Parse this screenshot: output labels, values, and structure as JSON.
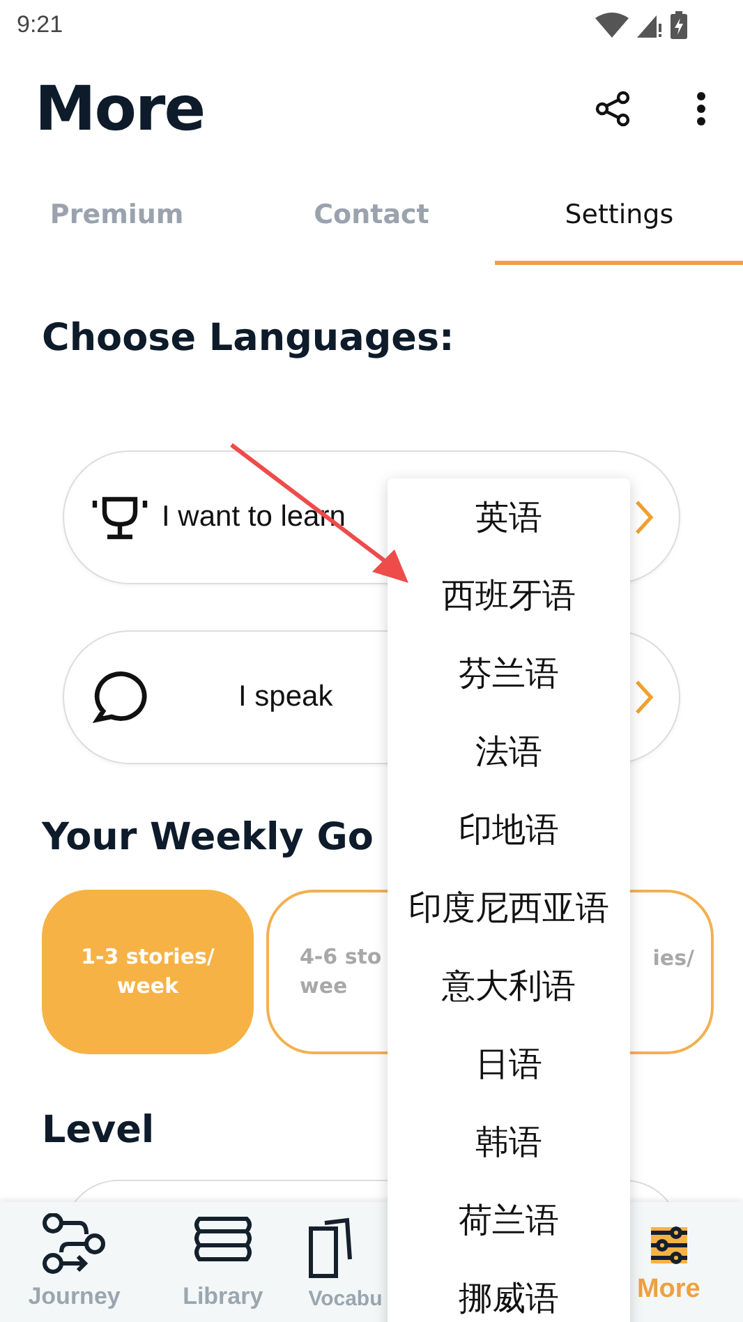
{
  "status_bar": {
    "time": "9:21"
  },
  "header": {
    "title": "More"
  },
  "tabs": [
    {
      "label": "Premium",
      "selected": false
    },
    {
      "label": "Contact",
      "selected": false
    },
    {
      "label": "Settings",
      "selected": true
    }
  ],
  "languages": {
    "title": "Choose Languages:",
    "rows": [
      {
        "kind": "learn",
        "label": "I want to learn"
      },
      {
        "kind": "speak",
        "label": "I speak"
      }
    ]
  },
  "weekly_goal": {
    "title": "Your Weekly Go",
    "options": [
      {
        "lines": [
          "1-3 stories/",
          "week"
        ],
        "selected": true
      },
      {
        "lines": [
          "4-6 sto",
          "wee"
        ],
        "selected": false
      },
      {
        "lines": [
          "ies/"
        ],
        "selected": false
      }
    ]
  },
  "level": {
    "title": "Level"
  },
  "language_menu": [
    "英语",
    "西班牙语",
    "芬兰语",
    "法语",
    "印地语",
    "印度尼西亚语",
    "意大利语",
    "日语",
    "韩语",
    "荷兰语",
    "挪威语"
  ],
  "bottom_nav": [
    {
      "kind": "journey",
      "label": "Journey",
      "selected": false
    },
    {
      "kind": "library",
      "label": "Library",
      "selected": false
    },
    {
      "kind": "vocab",
      "label": "Vocabu",
      "selected": false
    },
    {
      "kind": "more",
      "label": "More",
      "selected": true
    }
  ]
}
